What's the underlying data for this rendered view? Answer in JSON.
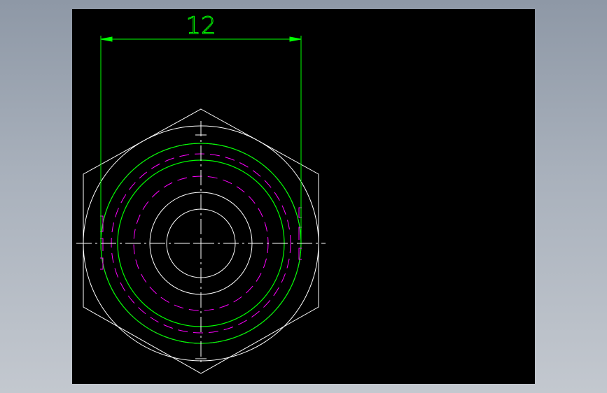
{
  "drawing": {
    "dimension_value": "12",
    "colors": {
      "background": "#000000",
      "geometry": "#ffffff",
      "dimension": "#00ff00",
      "hidden": "#ff00ff"
    }
  }
}
